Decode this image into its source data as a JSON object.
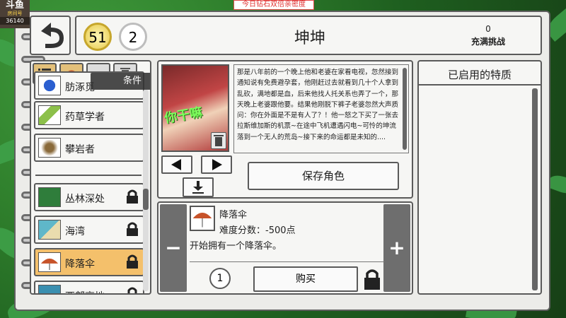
{
  "banner": "今日钻石双倍亲密度",
  "logo": {
    "brand": "斗鱼",
    "room_label": "房间号",
    "room_id": "36140"
  },
  "header": {
    "gold_coins": "51",
    "white_coins": "2",
    "character_name": "坤坤",
    "challenge_count": "0",
    "challenge_label": "充满挑战"
  },
  "tooltip": "条件",
  "list": {
    "items": [
      {
        "label": "肪涿觅"
      },
      {
        "label": "药草学者"
      },
      {
        "label": "攀岩者"
      },
      {
        "label": "丛林深处"
      },
      {
        "label": "海湾"
      },
      {
        "label": "降落伞"
      },
      {
        "label": "西部高地"
      }
    ]
  },
  "character": {
    "portrait_caption": "你干嘛",
    "description": "那是八年前的一个晚上他和老婆在家看电视，忽然接到通知说有免费避孕套，他刚赶过去就看到几十个人拿到乱砍，满地都是血，后来他找人托关系也弄了一个，那天晚上老婆跟他要。结果他刚脱下裤子老婆忽然大声质问：你在外面是不是有人了？！他一怒之下买了一张去拉斯维加斯的机票~在途中飞机遭遇闪电~可怜的坤流落到一个无人的荒岛~接下来的命运都是未知的....",
    "save_label": "保存角色"
  },
  "detail": {
    "name": "降落伞",
    "score": "难度分数：-500点",
    "desc": "开始拥有一个降落伞。",
    "count": "1",
    "buy_label": "购买"
  },
  "enabled": {
    "title": "已启用的特质"
  },
  "colors": {
    "accent": "#f4c06b",
    "banner_red": "#e03030"
  }
}
